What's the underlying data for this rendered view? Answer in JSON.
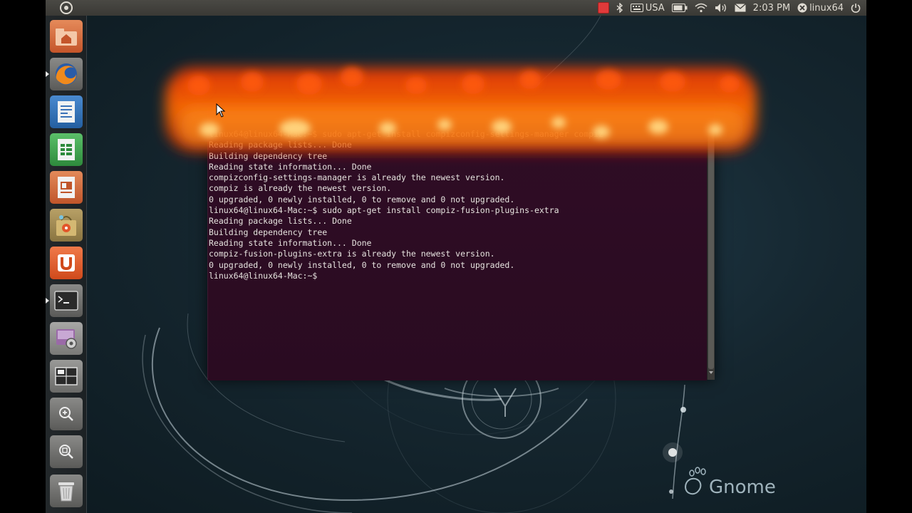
{
  "top_panel": {
    "keyboard_layout": "USA",
    "clock": "2:03 PM",
    "user": "linux64",
    "icons": [
      "red-square-indicator-icon",
      "bluetooth-icon",
      "keyboard-icon",
      "battery-icon",
      "wifi-icon",
      "volume-icon",
      "mail-icon",
      "user-icon",
      "power-icon"
    ]
  },
  "launcher": {
    "items": [
      {
        "name": "home-folder",
        "icon": "home-folder-icon",
        "color": "#d9683a"
      },
      {
        "name": "firefox",
        "icon": "firefox-icon",
        "color": "#e8741d"
      },
      {
        "name": "libreoffice-writer",
        "icon": "writer-icon",
        "color": "#2e6fb5"
      },
      {
        "name": "libreoffice-calc",
        "icon": "calc-icon",
        "color": "#3aa64a"
      },
      {
        "name": "libreoffice-impress",
        "icon": "impress-icon",
        "color": "#d9683a"
      },
      {
        "name": "ubuntu-software-center",
        "icon": "software-center-icon",
        "color": "#a38a4e"
      },
      {
        "name": "ubuntu-one",
        "icon": "ubuntu-one-icon",
        "color": "#e2562b",
        "label": "U"
      },
      {
        "name": "terminal",
        "icon": "terminal-icon",
        "color": "#4a4a48"
      },
      {
        "name": "compizconfig",
        "icon": "compizconfig-icon",
        "color": "#8c8c8c"
      },
      {
        "name": "workspace-switcher",
        "icon": "workspace-icon",
        "color": "#6a6a68"
      },
      {
        "name": "zoom-in",
        "icon": "zoom-in-icon",
        "color": "#6a6a68"
      },
      {
        "name": "zoom-out",
        "icon": "zoom-out-icon",
        "color": "#6a6a68"
      },
      {
        "name": "trash",
        "icon": "trash-icon",
        "color": "#6a6a68"
      }
    ]
  },
  "wallpaper": {
    "logo_text": "Gnome"
  },
  "terminal": {
    "lines": [
      "linux64@linux64-Mac:~$ sudo apt-get install compizconfig-settings-manager compiz",
      "Reading package lists... Done",
      "Building dependency tree",
      "Reading state information... Done",
      "compizconfig-settings-manager is already the newest version.",
      "compiz is already the newest version.",
      "0 upgraded, 0 newly installed, 0 to remove and 0 not upgraded.",
      "linux64@linux64-Mac:~$ sudo apt-get install compiz-fusion-plugins-extra",
      "Reading package lists... Done",
      "Building dependency tree",
      "Reading state information... Done",
      "compiz-fusion-plugins-extra is already the newest version.",
      "0 upgraded, 0 newly installed, 0 to remove and 0 not upgraded.",
      "linux64@linux64-Mac:~$"
    ]
  }
}
